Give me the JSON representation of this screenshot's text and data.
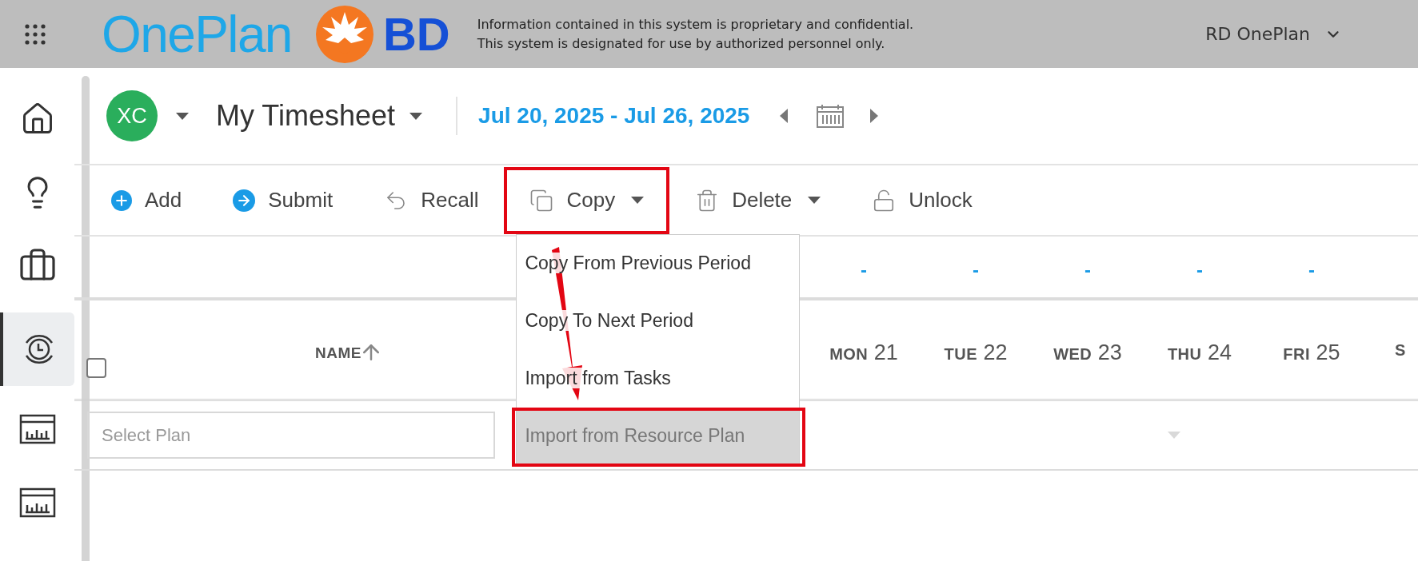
{
  "header": {
    "logo": "OnePlan",
    "brand": "BD",
    "notice": [
      "Information contained in this system is proprietary and confidential.",
      "This system is designated for use by authorized personnel only."
    ],
    "workspace": "RD OnePlan"
  },
  "sidebar": {
    "items": [
      {
        "kind": "home",
        "selected": false
      },
      {
        "kind": "ideas",
        "selected": false
      },
      {
        "kind": "projects",
        "selected": false
      },
      {
        "kind": "timesheet",
        "selected": true
      },
      {
        "kind": "report",
        "selected": false
      },
      {
        "kind": "report",
        "selected": false
      }
    ]
  },
  "title_bar": {
    "avatar": "XC",
    "title": "My Timesheet",
    "period": "Jul 20, 2025 - Jul 26, 2025"
  },
  "toolbar": [
    {
      "kind": "add",
      "label": "Add",
      "menu": false
    },
    {
      "kind": "submit",
      "label": "Submit",
      "menu": false
    },
    {
      "kind": "recall",
      "label": "Recall",
      "menu": false
    },
    {
      "kind": "copy",
      "label": "Copy",
      "menu": true
    },
    {
      "kind": "delete",
      "label": "Delete",
      "menu": true
    },
    {
      "kind": "unlock",
      "label": "Unlock",
      "menu": false
    }
  ],
  "copy_menu": [
    {
      "label": "Copy From Previous Period",
      "selected": false
    },
    {
      "label": "Copy To Next Period",
      "selected": false
    },
    {
      "label": "Import from Tasks",
      "selected": false
    },
    {
      "label": "Import from Resource Plan",
      "selected": true
    }
  ],
  "totals": [
    "-",
    "-",
    "-",
    "-",
    "-"
  ],
  "table": {
    "select_all": {
      "checked": false
    },
    "name_column": "NAME",
    "columns": [
      {
        "day": "MON",
        "date": "21"
      },
      {
        "day": "TUE",
        "date": "22"
      },
      {
        "day": "WED",
        "date": "23"
      },
      {
        "day": "THU",
        "date": "24"
      },
      {
        "day": "FRI",
        "date": "25"
      },
      {
        "day": "S"
      }
    ],
    "rows": [
      {
        "plan": {
          "placeholder": "Select Plan"
        }
      }
    ]
  }
}
